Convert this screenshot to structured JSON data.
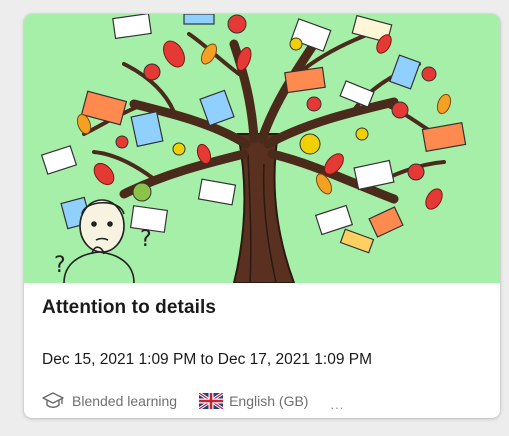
{
  "card": {
    "title": "Attention to details",
    "dates": "Dec 15, 2021 1:09 PM to Dec 17, 2021 1:09 PM",
    "format_icon": "graduation-cap-icon",
    "format_label": "Blended learning",
    "language_icon": "uk-flag-icon",
    "language_label": "English (GB)",
    "more_label": "...",
    "hero_icon": "knowledge-tree-illustration",
    "hero_background": "#a6efa8"
  }
}
